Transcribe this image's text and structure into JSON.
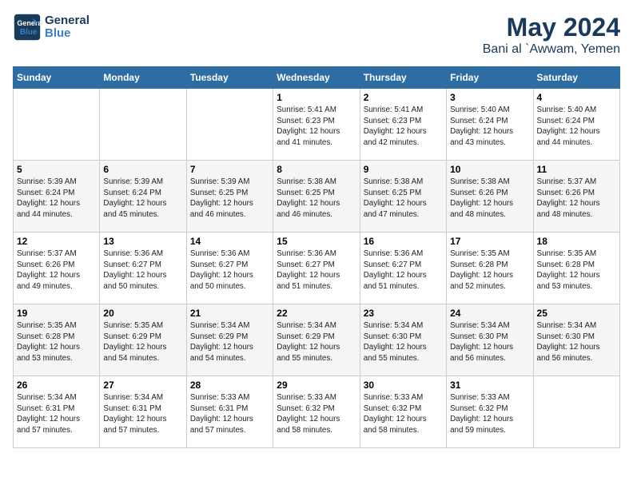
{
  "logo": {
    "line1": "General",
    "line2": "Blue"
  },
  "title": "May 2024",
  "location": "Bani al `Awwam, Yemen",
  "weekdays": [
    "Sunday",
    "Monday",
    "Tuesday",
    "Wednesday",
    "Thursday",
    "Friday",
    "Saturday"
  ],
  "weeks": [
    [
      {
        "day": "",
        "sunrise": "",
        "sunset": "",
        "daylight": ""
      },
      {
        "day": "",
        "sunrise": "",
        "sunset": "",
        "daylight": ""
      },
      {
        "day": "",
        "sunrise": "",
        "sunset": "",
        "daylight": ""
      },
      {
        "day": "1",
        "sunrise": "Sunrise: 5:41 AM",
        "sunset": "Sunset: 6:23 PM",
        "daylight": "Daylight: 12 hours and 41 minutes."
      },
      {
        "day": "2",
        "sunrise": "Sunrise: 5:41 AM",
        "sunset": "Sunset: 6:23 PM",
        "daylight": "Daylight: 12 hours and 42 minutes."
      },
      {
        "day": "3",
        "sunrise": "Sunrise: 5:40 AM",
        "sunset": "Sunset: 6:24 PM",
        "daylight": "Daylight: 12 hours and 43 minutes."
      },
      {
        "day": "4",
        "sunrise": "Sunrise: 5:40 AM",
        "sunset": "Sunset: 6:24 PM",
        "daylight": "Daylight: 12 hours and 44 minutes."
      }
    ],
    [
      {
        "day": "5",
        "sunrise": "Sunrise: 5:39 AM",
        "sunset": "Sunset: 6:24 PM",
        "daylight": "Daylight: 12 hours and 44 minutes."
      },
      {
        "day": "6",
        "sunrise": "Sunrise: 5:39 AM",
        "sunset": "Sunset: 6:24 PM",
        "daylight": "Daylight: 12 hours and 45 minutes."
      },
      {
        "day": "7",
        "sunrise": "Sunrise: 5:39 AM",
        "sunset": "Sunset: 6:25 PM",
        "daylight": "Daylight: 12 hours and 46 minutes."
      },
      {
        "day": "8",
        "sunrise": "Sunrise: 5:38 AM",
        "sunset": "Sunset: 6:25 PM",
        "daylight": "Daylight: 12 hours and 46 minutes."
      },
      {
        "day": "9",
        "sunrise": "Sunrise: 5:38 AM",
        "sunset": "Sunset: 6:25 PM",
        "daylight": "Daylight: 12 hours and 47 minutes."
      },
      {
        "day": "10",
        "sunrise": "Sunrise: 5:38 AM",
        "sunset": "Sunset: 6:26 PM",
        "daylight": "Daylight: 12 hours and 48 minutes."
      },
      {
        "day": "11",
        "sunrise": "Sunrise: 5:37 AM",
        "sunset": "Sunset: 6:26 PM",
        "daylight": "Daylight: 12 hours and 48 minutes."
      }
    ],
    [
      {
        "day": "12",
        "sunrise": "Sunrise: 5:37 AM",
        "sunset": "Sunset: 6:26 PM",
        "daylight": "Daylight: 12 hours and 49 minutes."
      },
      {
        "day": "13",
        "sunrise": "Sunrise: 5:36 AM",
        "sunset": "Sunset: 6:27 PM",
        "daylight": "Daylight: 12 hours and 50 minutes."
      },
      {
        "day": "14",
        "sunrise": "Sunrise: 5:36 AM",
        "sunset": "Sunset: 6:27 PM",
        "daylight": "Daylight: 12 hours and 50 minutes."
      },
      {
        "day": "15",
        "sunrise": "Sunrise: 5:36 AM",
        "sunset": "Sunset: 6:27 PM",
        "daylight": "Daylight: 12 hours and 51 minutes."
      },
      {
        "day": "16",
        "sunrise": "Sunrise: 5:36 AM",
        "sunset": "Sunset: 6:27 PM",
        "daylight": "Daylight: 12 hours and 51 minutes."
      },
      {
        "day": "17",
        "sunrise": "Sunrise: 5:35 AM",
        "sunset": "Sunset: 6:28 PM",
        "daylight": "Daylight: 12 hours and 52 minutes."
      },
      {
        "day": "18",
        "sunrise": "Sunrise: 5:35 AM",
        "sunset": "Sunset: 6:28 PM",
        "daylight": "Daylight: 12 hours and 53 minutes."
      }
    ],
    [
      {
        "day": "19",
        "sunrise": "Sunrise: 5:35 AM",
        "sunset": "Sunset: 6:28 PM",
        "daylight": "Daylight: 12 hours and 53 minutes."
      },
      {
        "day": "20",
        "sunrise": "Sunrise: 5:35 AM",
        "sunset": "Sunset: 6:29 PM",
        "daylight": "Daylight: 12 hours and 54 minutes."
      },
      {
        "day": "21",
        "sunrise": "Sunrise: 5:34 AM",
        "sunset": "Sunset: 6:29 PM",
        "daylight": "Daylight: 12 hours and 54 minutes."
      },
      {
        "day": "22",
        "sunrise": "Sunrise: 5:34 AM",
        "sunset": "Sunset: 6:29 PM",
        "daylight": "Daylight: 12 hours and 55 minutes."
      },
      {
        "day": "23",
        "sunrise": "Sunrise: 5:34 AM",
        "sunset": "Sunset: 6:30 PM",
        "daylight": "Daylight: 12 hours and 55 minutes."
      },
      {
        "day": "24",
        "sunrise": "Sunrise: 5:34 AM",
        "sunset": "Sunset: 6:30 PM",
        "daylight": "Daylight: 12 hours and 56 minutes."
      },
      {
        "day": "25",
        "sunrise": "Sunrise: 5:34 AM",
        "sunset": "Sunset: 6:30 PM",
        "daylight": "Daylight: 12 hours and 56 minutes."
      }
    ],
    [
      {
        "day": "26",
        "sunrise": "Sunrise: 5:34 AM",
        "sunset": "Sunset: 6:31 PM",
        "daylight": "Daylight: 12 hours and 57 minutes."
      },
      {
        "day": "27",
        "sunrise": "Sunrise: 5:34 AM",
        "sunset": "Sunset: 6:31 PM",
        "daylight": "Daylight: 12 hours and 57 minutes."
      },
      {
        "day": "28",
        "sunrise": "Sunrise: 5:33 AM",
        "sunset": "Sunset: 6:31 PM",
        "daylight": "Daylight: 12 hours and 57 minutes."
      },
      {
        "day": "29",
        "sunrise": "Sunrise: 5:33 AM",
        "sunset": "Sunset: 6:32 PM",
        "daylight": "Daylight: 12 hours and 58 minutes."
      },
      {
        "day": "30",
        "sunrise": "Sunrise: 5:33 AM",
        "sunset": "Sunset: 6:32 PM",
        "daylight": "Daylight: 12 hours and 58 minutes."
      },
      {
        "day": "31",
        "sunrise": "Sunrise: 5:33 AM",
        "sunset": "Sunset: 6:32 PM",
        "daylight": "Daylight: 12 hours and 59 minutes."
      },
      {
        "day": "",
        "sunrise": "",
        "sunset": "",
        "daylight": ""
      }
    ]
  ]
}
